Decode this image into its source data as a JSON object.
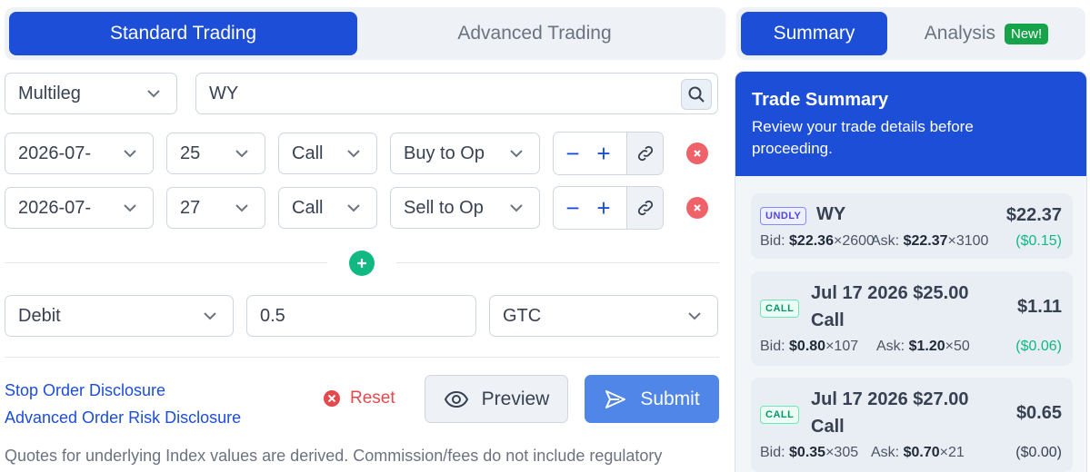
{
  "tabs": {
    "standard": "Standard Trading",
    "advanced": "Advanced Trading"
  },
  "order": {
    "strategy": "Multileg",
    "symbol": "WY",
    "legs": [
      {
        "expiry": "2026-07-",
        "strike": "25",
        "type": "Call",
        "action": "Buy to Op",
        "stepper_minus": "−",
        "stepper_plus": "+"
      },
      {
        "expiry": "2026-07-",
        "strike": "27",
        "type": "Call",
        "action": "Sell to Op",
        "stepper_minus": "−",
        "stepper_plus": "+"
      }
    ],
    "price_type": "Debit",
    "limit_price": "0.5",
    "duration": "GTC"
  },
  "links": {
    "stop_disclosure": "Stop Order Disclosure",
    "risk_disclosure": "Advanced Order Risk Disclosure"
  },
  "actions": {
    "reset": "Reset",
    "preview": "Preview",
    "submit": "Submit"
  },
  "footnote": "Quotes for underlying Index values are derived. Commission/fees do not include regulatory",
  "right_tabs": {
    "summary": "Summary",
    "analysis": "Analysis",
    "new_badge": "New!"
  },
  "summary": {
    "title": "Trade Summary",
    "subtitle": "Review your trade details before proceeding.",
    "cards": [
      {
        "tag": "UNDLY",
        "title": "WY",
        "price": "$22.37",
        "bid_label": "Bid:",
        "bid": "$22.36",
        "bid_size": "×2600",
        "ask_label": "Ask:",
        "ask": "$22.37",
        "ask_size": "×3100",
        "change": "($0.15)"
      },
      {
        "tag": "CALL",
        "title_line1": "Jul 17 2026 $25.00",
        "title_line2": "Call",
        "price": "$1.11",
        "bid_label": "Bid:",
        "bid": "$0.80",
        "bid_size": "×107",
        "ask_label": "Ask:",
        "ask": "$1.20",
        "ask_size": "×50",
        "change": "($0.06)"
      },
      {
        "tag": "CALL",
        "title_line1": "Jul 17 2026 $27.00",
        "title_line2": "Call",
        "price": "$0.65",
        "bid_label": "Bid:",
        "bid": "$0.35",
        "bid_size": "×305",
        "ask_label": "Ask:",
        "ask": "$0.70",
        "ask_size": "×21",
        "change": "($0.00)"
      }
    ]
  },
  "colors": {
    "primary": "#1d4ed8",
    "submit": "#4f86e8",
    "danger": "#f0626a",
    "success": "#10b981"
  }
}
